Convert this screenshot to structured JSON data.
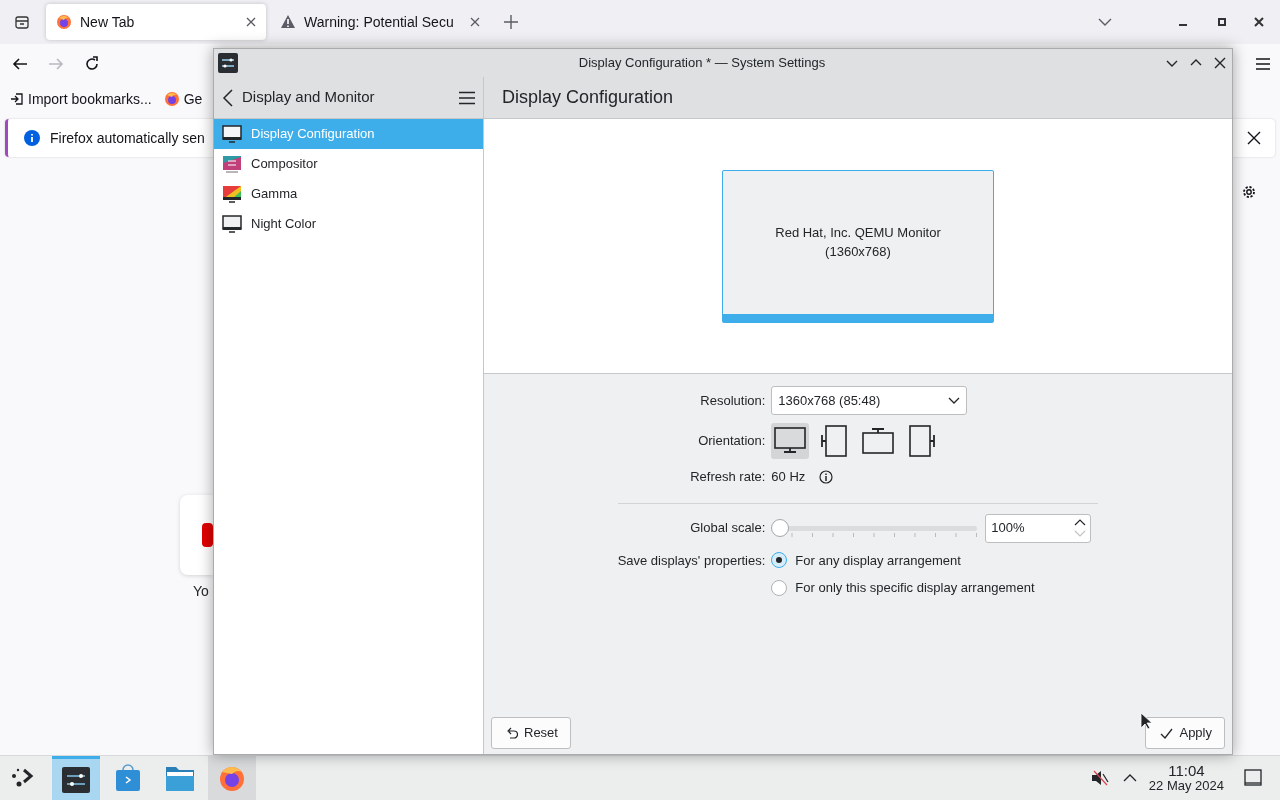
{
  "browser": {
    "tabs": [
      {
        "kind": "firefox",
        "label": "New Tab",
        "selected": true
      },
      {
        "kind": "warning",
        "label": "Warning: Potential Secu",
        "selected": false
      }
    ],
    "nav": [
      {
        "kind": "back",
        "disabled": false
      },
      {
        "kind": "forward",
        "disabled": true
      },
      {
        "kind": "reload",
        "disabled": false
      }
    ],
    "bookmarks": [
      {
        "kind": "import",
        "label": "Import bookmarks..."
      },
      {
        "kind": "firefox",
        "label": "Ge"
      }
    ],
    "notification": "Firefox automatically sen",
    "shortcut": {
      "label": "Yo"
    }
  },
  "settings": {
    "title": "Display Configuration * — System Settings",
    "sidebar": {
      "title": "Display and Monitor",
      "items": [
        {
          "kind": "display",
          "label": "Display Configuration",
          "selected": true
        },
        {
          "kind": "compositor",
          "label": "Compositor",
          "selected": false
        },
        {
          "kind": "gamma",
          "label": "Gamma",
          "selected": false
        },
        {
          "kind": "night",
          "label": "Night Color",
          "selected": false
        }
      ]
    },
    "page_title": "Display Configuration",
    "monitor": {
      "name": "Red Hat, Inc. QEMU Monitor",
      "size": "(1360x768)"
    },
    "form": {
      "resolution": {
        "label": "Resolution:",
        "value": "1360x768 (85:48)"
      },
      "orientation": {
        "label": "Orientation:",
        "options": [
          {
            "kind": "landscape",
            "selected": true
          },
          {
            "kind": "portrait-left",
            "selected": false
          },
          {
            "kind": "landscape-flipped",
            "selected": false
          },
          {
            "kind": "portrait-right",
            "selected": false
          }
        ]
      },
      "refresh": {
        "label": "Refresh rate:",
        "value": "60 Hz"
      },
      "scale": {
        "label": "Global scale:",
        "level": 0,
        "value": "100%"
      },
      "save": {
        "label": "Save displays' properties:",
        "options": [
          {
            "label": "For any display arrangement",
            "selected": true
          },
          {
            "label": "For only this specific display arrangement",
            "selected": false
          }
        ]
      }
    },
    "buttons": {
      "reset": "Reset",
      "apply": "Apply"
    }
  },
  "taskbar": {
    "apps": [
      {
        "kind": "launcher",
        "selected": false,
        "running": false
      },
      {
        "kind": "settings",
        "selected": true,
        "running": true
      },
      {
        "kind": "discover",
        "selected": false,
        "running": false
      },
      {
        "kind": "files",
        "selected": false,
        "running": false
      },
      {
        "kind": "firefox",
        "selected": false,
        "running": true
      }
    ],
    "clock": {
      "time": "11:04",
      "date": "22 May 2024"
    }
  }
}
